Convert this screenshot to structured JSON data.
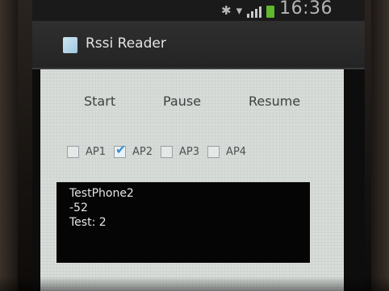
{
  "status_bar": {
    "clock": "16:36",
    "bluetooth_icon": "bluetooth-icon",
    "wifi_icon": "wifi-icon",
    "signal_icon": "signal-icon",
    "battery_icon": "battery-icon",
    "battery_color": "#5fb82e"
  },
  "app": {
    "title": "Rssi Reader",
    "icon": "app-icon"
  },
  "controls": {
    "start_label": "Start",
    "pause_label": "Pause",
    "resume_label": "Resume"
  },
  "access_points": [
    {
      "label": "AP1",
      "checked": false
    },
    {
      "label": "AP2",
      "checked": true
    },
    {
      "label": "AP3",
      "checked": false
    },
    {
      "label": "AP4",
      "checked": false
    }
  ],
  "output": {
    "device": "TestPhone2",
    "rssi": "-52",
    "test": "Test: 2"
  },
  "colors": {
    "checkbox_accent": "#3a8fd0",
    "content_bg": "#d7dcd8",
    "output_bg": "#050505",
    "output_text": "#e6e6e6"
  }
}
